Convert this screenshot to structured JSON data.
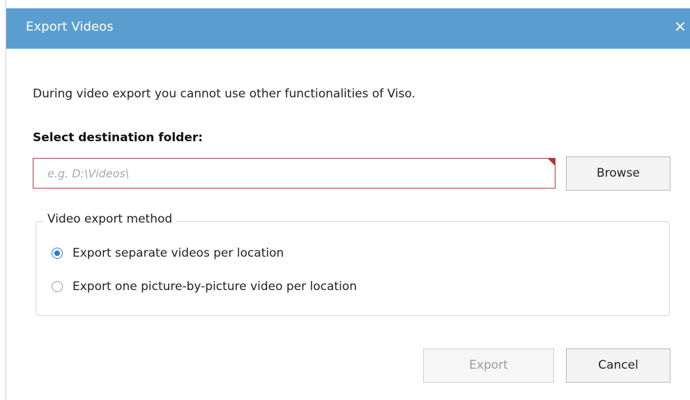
{
  "dialog": {
    "title": "Export Videos",
    "close_glyph": "×"
  },
  "info_text": "During video export you cannot use other functionalities of Viso.",
  "destination": {
    "label": "Select destination folder:",
    "value": "",
    "placeholder": "e.g. D:\\Videos\\",
    "browse_label": "Browse"
  },
  "export_method": {
    "legend": "Video export method",
    "options": [
      {
        "label": "Export separate videos per location",
        "selected": true
      },
      {
        "label": "Export one picture-by-picture video per location",
        "selected": false
      }
    ]
  },
  "footer": {
    "export_label": "Export",
    "cancel_label": "Cancel"
  },
  "colors": {
    "titlebar": "#5a9ecf",
    "error_border": "#b03a3a",
    "radio_accent": "#2b7bd6"
  }
}
